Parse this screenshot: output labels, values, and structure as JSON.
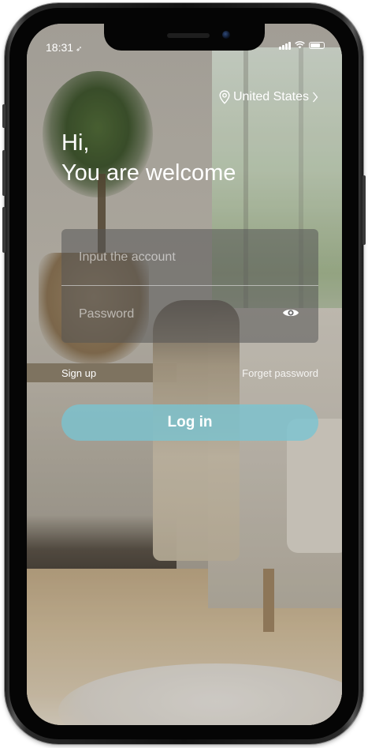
{
  "status_bar": {
    "time": "18:31",
    "location_arrow": "➶"
  },
  "region": {
    "label": "United States"
  },
  "greeting": {
    "line1": "Hi,",
    "line2": "You are welcome"
  },
  "form": {
    "account_placeholder": "Input the account",
    "password_placeholder": "Password",
    "account_value": "",
    "password_value": ""
  },
  "links": {
    "sign_up": "Sign up",
    "forget_password": "Forget password"
  },
  "login": {
    "label": "Log in"
  },
  "colors": {
    "login_button": "#78c4d2",
    "text": "#ffffff"
  },
  "icons": {
    "region_pin": "location-pin-icon",
    "region_chevron": "chevron-right-icon",
    "password_toggle": "eye-icon",
    "wifi": "wifi-icon",
    "battery": "battery-icon",
    "signal": "signal-icon"
  }
}
